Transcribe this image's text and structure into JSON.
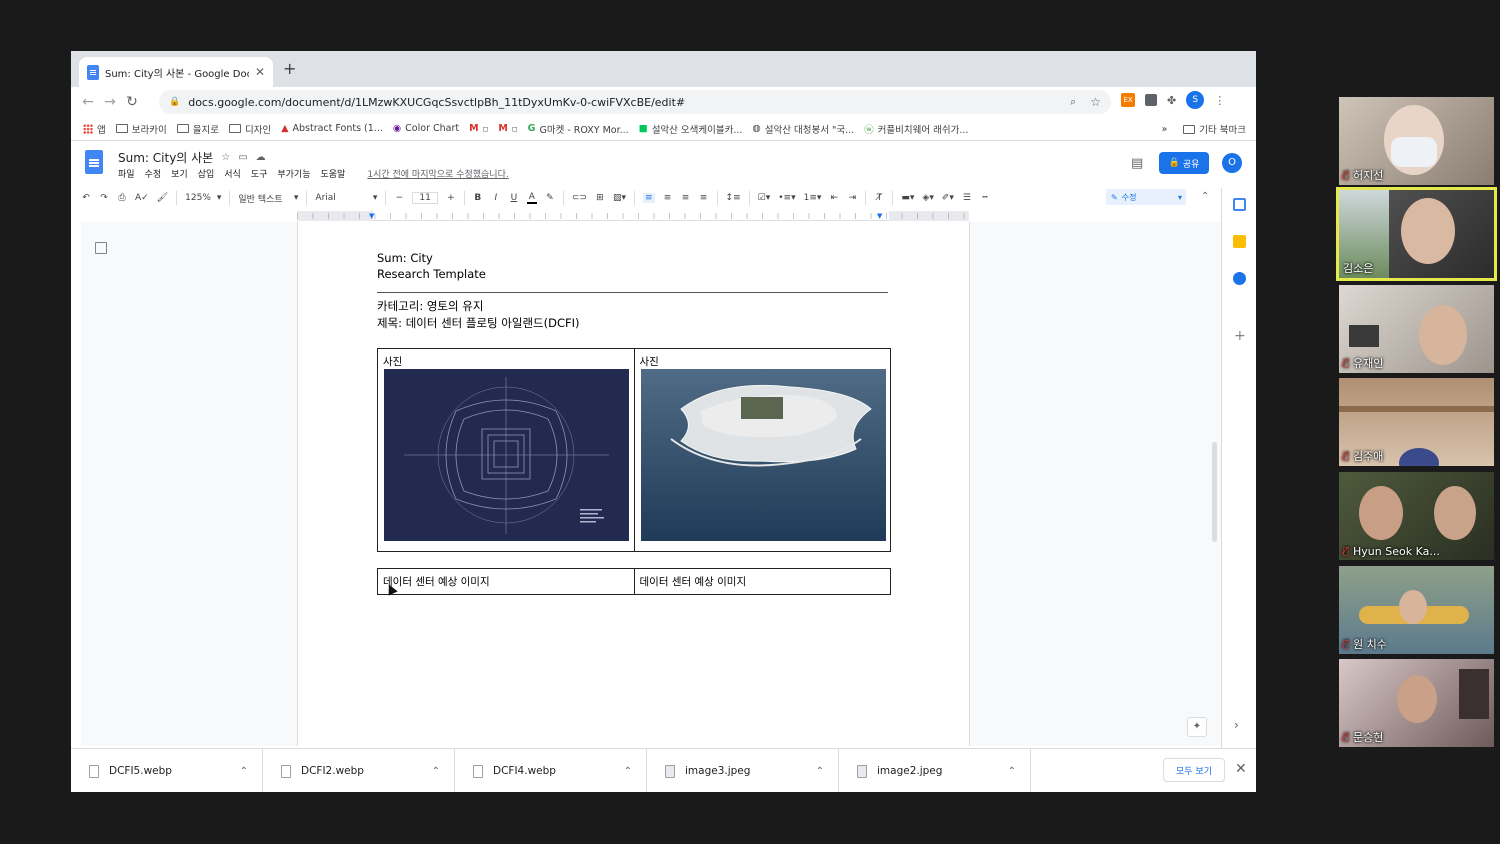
{
  "browser": {
    "tab_title": "Sum: City의 사본 - Google Docs",
    "new_tab": "+",
    "url": "docs.google.com/document/d/1LMzwKXUCGqcSsvctlpBh_11tDyxUmKv-0-cwiFVXcBE/edit#",
    "profile_initial": "S",
    "ext_badge": "EX"
  },
  "bookmarks": {
    "items": [
      "앱",
      "보라카이",
      "을지로",
      "디자인",
      "Abstract Fonts (1...",
      "Color Chart",
      "",
      "",
      "G마켓 - ROXY Mor...",
      "설악산 오색케이블카...",
      "설악산 대청봉서 \"국...",
      "커플비치웨어 래쉬가..."
    ],
    "more": "»",
    "other": "기타 북마크"
  },
  "docs": {
    "title": "Sum: City의 사본",
    "menu": [
      "파일",
      "수정",
      "보기",
      "삽입",
      "서식",
      "도구",
      "부가기능",
      "도움말"
    ],
    "last_edit": "1시간 전에 마지막으로 수정했습니다.",
    "share_label": "공유",
    "account_initial": "O",
    "toolbar": {
      "zoom": "125%",
      "style": "일반 텍스트",
      "font": "Arial",
      "font_size": "11",
      "mode": "수정"
    }
  },
  "document": {
    "heading_line1": "Sum: City",
    "heading_line2": "Research Template",
    "category": "카테고리: 영토의 유지",
    "subject": "제목: 데이터 센터 플로팅 아일랜드(DCFI)",
    "photo_label_1": "사진",
    "photo_label_2": "사진",
    "caption_1": "데이터 센터 예상 이미지",
    "caption_2": "데이터 센터 예상 이미지"
  },
  "downloads": {
    "files": [
      "DCFI5.webp",
      "DCFI2.webp",
      "DCFI4.webp",
      "image3.jpeg",
      "image2.jpeg"
    ],
    "show_all": "모두 보기"
  },
  "participants": [
    {
      "name": "허지선",
      "muted": true
    },
    {
      "name": "김소은",
      "muted": false,
      "active_speaker": true
    },
    {
      "name": "유재인",
      "muted": true
    },
    {
      "name": "김주애",
      "muted": true
    },
    {
      "name": "Hyun Seok Ka...",
      "muted": true
    },
    {
      "name": "원 치수",
      "muted": true
    },
    {
      "name": "문승현",
      "muted": true
    }
  ],
  "colors": {
    "active_speaker_border": "#e6e94b",
    "docs_blue": "#1a73e8",
    "muted_red": "#e53935"
  }
}
